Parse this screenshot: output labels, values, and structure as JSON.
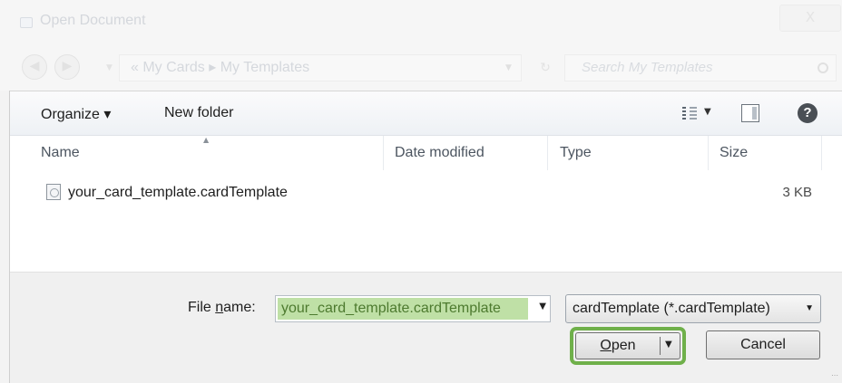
{
  "window": {
    "title": "Open Document",
    "close_label": "X"
  },
  "nav": {
    "back_glyph": "◀",
    "forward_glyph": "▶",
    "breadcrumb": "«  My Cards  ▸  My Templates",
    "search_placeholder": "Search My Templates"
  },
  "toolbar": {
    "organize_label": "Organize ▾",
    "new_folder_label": "New folder",
    "help_label": "?"
  },
  "columns": {
    "name": "Name",
    "date_modified": "Date modified",
    "type": "Type",
    "size": "Size"
  },
  "files": [
    {
      "name": "your_card_template.cardTemplate",
      "date_modified": "",
      "type": "",
      "size": "3 KB"
    }
  ],
  "bottom": {
    "file_name_label_pre": "File ",
    "file_name_label_accel": "n",
    "file_name_label_post": "ame:",
    "file_name_value": "your_card_template.cardTemplate",
    "filter_value": "cardTemplate (*.cardTemplate)",
    "open_label_accel": "O",
    "open_label_post": "pen",
    "cancel_label": "Cancel"
  },
  "colors": {
    "highlight_green": "#6fb04a",
    "selection_fill": "#bfe0a6"
  },
  "icons": {
    "view": "view-list-icon",
    "pane": "preview-pane-icon",
    "help": "help-icon",
    "file": "template-file-icon",
    "search": "search-icon"
  }
}
